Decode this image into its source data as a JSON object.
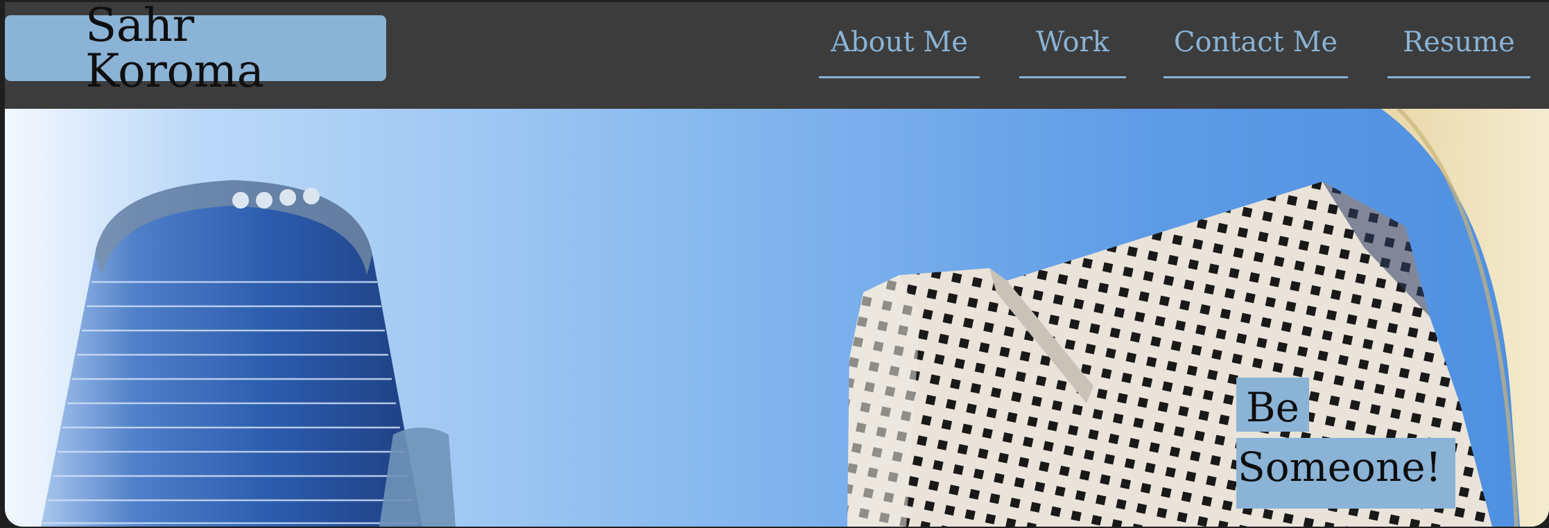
{
  "site": {
    "brand": "Sahr Koroma"
  },
  "nav": {
    "items": [
      {
        "label": "About Me"
      },
      {
        "label": "Work"
      },
      {
        "label": "Contact Me"
      },
      {
        "label": "Resume"
      }
    ]
  },
  "hero": {
    "image": "city-skyscrapers-photo",
    "tagline_line1": "Be",
    "tagline_line2": "Someone!"
  },
  "colors": {
    "background": "#3c3c3c",
    "accent": "#8ab3d6",
    "brand_text": "#0f0f0f"
  }
}
